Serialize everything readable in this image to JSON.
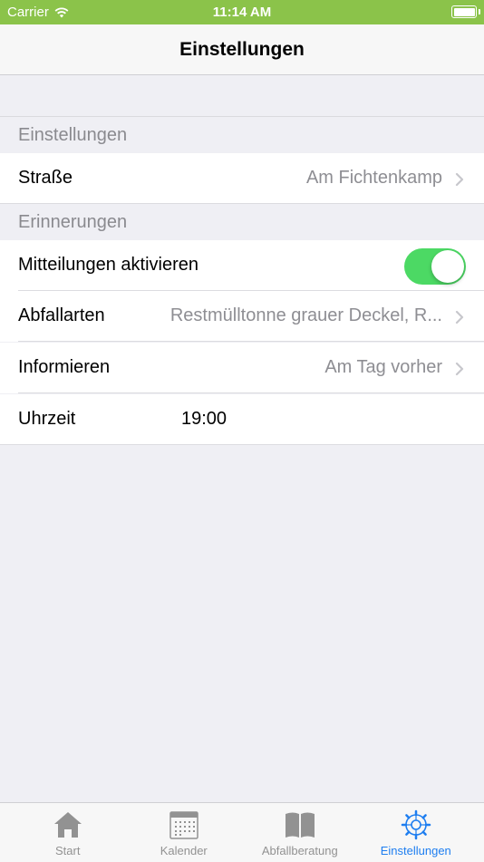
{
  "status_bar": {
    "carrier": "Carrier",
    "time": "11:14 AM"
  },
  "nav": {
    "title": "Einstellungen"
  },
  "sections": [
    {
      "header": "Einstellungen",
      "rows": [
        {
          "label": "Straße",
          "value": "Am Fichtenkamp"
        }
      ]
    },
    {
      "header": "Erinnerungen",
      "rows": [
        {
          "label": "Mitteilungen aktivieren",
          "toggle_on": true
        },
        {
          "label": "Abfallarten",
          "value": "Restmülltonne grauer Deckel, R..."
        },
        {
          "label": "Informieren",
          "value": "Am Tag vorher"
        },
        {
          "label": "Uhrzeit",
          "value": "19:00"
        }
      ]
    }
  ],
  "tab_bar": {
    "tabs": [
      {
        "label": "Start",
        "icon": "house-icon"
      },
      {
        "label": "Kalender",
        "icon": "calendar-icon"
      },
      {
        "label": "Abfallberatung",
        "icon": "book-icon"
      },
      {
        "label": "Einstellungen",
        "icon": "gear-icon",
        "active": true
      }
    ]
  },
  "colors": {
    "status_bar": "#8bc34a",
    "toggle_on": "#4cd964",
    "tab_active": "#1e7ef0",
    "tab_inactive": "#929292",
    "background": "#efeff4"
  }
}
